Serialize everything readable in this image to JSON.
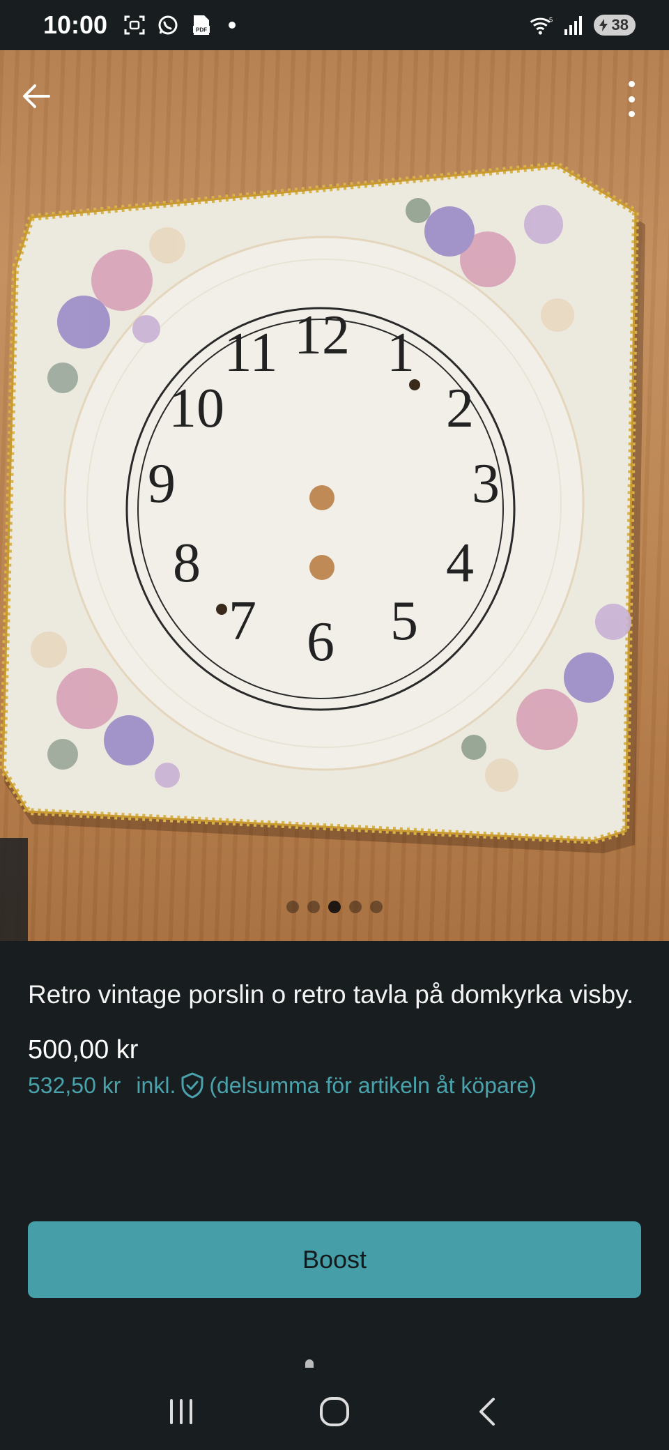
{
  "status_bar": {
    "time": "10:00",
    "left_icons": [
      "screenshot-icon",
      "whatsapp-icon",
      "pdf-icon"
    ],
    "right_icons": [
      "wifi-icon",
      "signal-icon"
    ],
    "battery_level": "38"
  },
  "photo": {
    "description_icon": "clock-face-photo",
    "page_count": 5,
    "active_page": 3
  },
  "listing": {
    "title": "Retro vintage porslin o retro tavla på domkyrka visby.",
    "price": "500,00 kr",
    "buyer_price": "532,50 kr",
    "buyer_price_incl": "inkl.",
    "buyer_price_note": "(delsumma för artikeln åt köpare)"
  },
  "actions": {
    "boost_label": "Boost"
  },
  "colors": {
    "background": "#181e1f",
    "accent": "#459ea8",
    "accent_text": "#4aa3ac"
  }
}
